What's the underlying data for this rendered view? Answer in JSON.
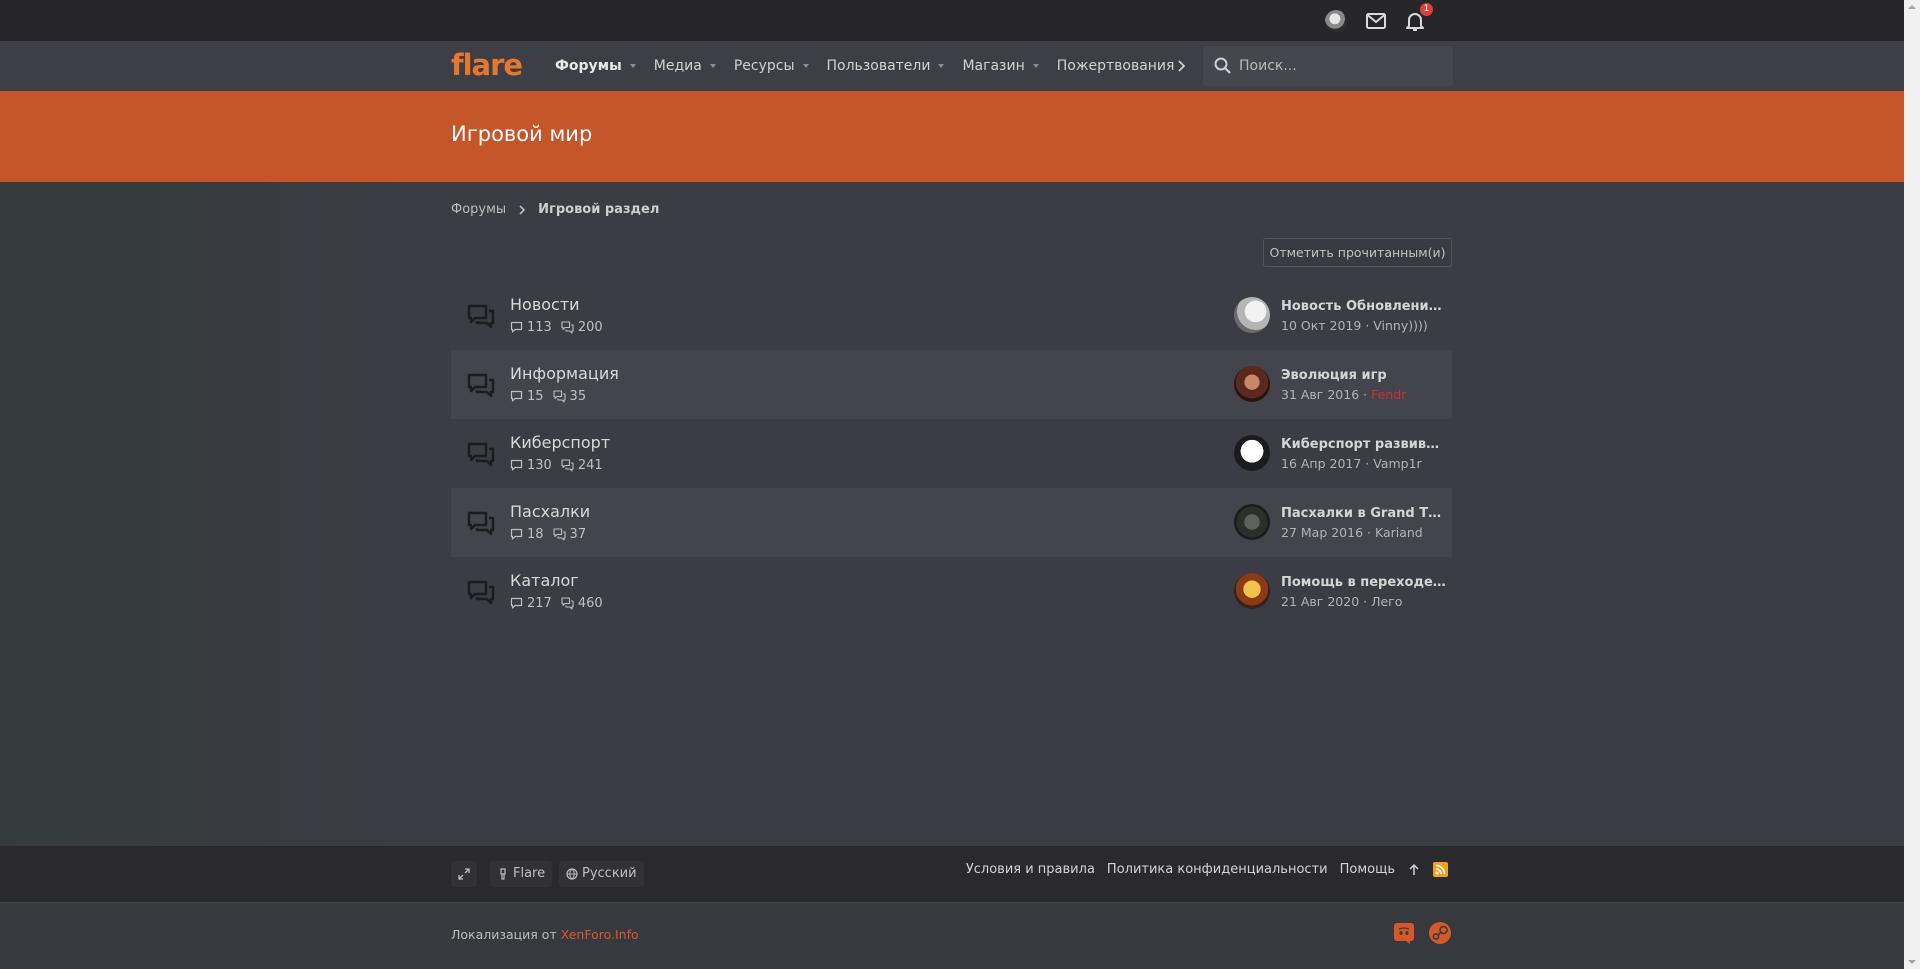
{
  "topbar": {
    "notification_count": "1"
  },
  "nav": {
    "items": [
      {
        "label": "Форумы",
        "has_caret": true,
        "active": true
      },
      {
        "label": "Медиа",
        "has_caret": true
      },
      {
        "label": "Ресурсы",
        "has_caret": true
      },
      {
        "label": "Пользователи",
        "has_caret": true
      },
      {
        "label": "Магазин",
        "has_caret": true
      },
      {
        "label": "Пожертвования",
        "has_caret": false
      }
    ],
    "search_placeholder": "Поиск..."
  },
  "banner": {
    "title": "Игровой мир"
  },
  "breadcrumb": {
    "root": "Форумы",
    "current": "Игровой раздел"
  },
  "mark_read_label": "Отметить прочитанным(и)",
  "forums": [
    {
      "title": "Новости",
      "threads": "113",
      "messages": "200",
      "last_title": "Новость Обновление…",
      "last_date": "10 Окт 2019",
      "last_user": "Vinny))))"
    },
    {
      "title": "Информация",
      "threads": "15",
      "messages": "35",
      "last_title": "Эволюция игр",
      "last_date": "31 Авг 2016",
      "last_user": "Fendr"
    },
    {
      "title": "Киберспорт",
      "threads": "130",
      "messages": "241",
      "last_title": "Киберспорт развива…",
      "last_date": "16 Апр 2017",
      "last_user": "Vamp1r"
    },
    {
      "title": "Пасхалки",
      "threads": "18",
      "messages": "37",
      "last_title": "Пасхалки в Grand The…",
      "last_date": "27 Мар 2016",
      "last_user": "Kariand"
    },
    {
      "title": "Каталог",
      "threads": "217",
      "messages": "460",
      "last_title": "Помощь в переходе …",
      "last_date": "21 Авг 2020",
      "last_user": "Лего"
    }
  ],
  "footer": {
    "style_label": "Flare",
    "language_label": "Русский",
    "links": {
      "terms": "Условия и правила",
      "privacy": "Политика конфиденциальности",
      "help": "Помощь"
    },
    "localization_prefix": "Локализация от",
    "localization_link": "XenForo.Info"
  },
  "colors": {
    "accent": "#c4562a",
    "logo": "#e8772e",
    "red_user": "#c6352e"
  }
}
